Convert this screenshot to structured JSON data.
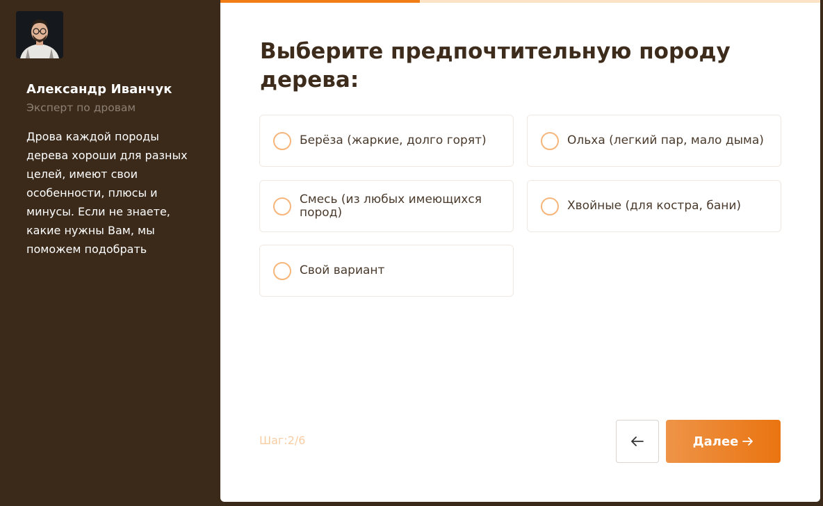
{
  "expert": {
    "name": "Александр Иванчук",
    "role": "Эксперт по дровам",
    "description": "Дрова каждой породы дерева хороши для разных целей, имеют свои особенности, плюсы и минусы. Если не знаете, какие нужны Вам, мы поможем подобрать"
  },
  "quiz": {
    "progress": 0.333,
    "question": "Выберите предпочтительную породу дерева:",
    "options": [
      {
        "label": "Берёза (жаркие, долго горят)"
      },
      {
        "label": "Ольха (легкий пар, мало дыма)"
      },
      {
        "label": "Смесь (из любых имеющихся пород)"
      },
      {
        "label": "Хвойные (для костра, бани)"
      },
      {
        "label": "Свой вариант"
      }
    ],
    "step": "Шаг:2/6",
    "back_icon": "arrow-left-icon",
    "next_label": "Далее",
    "next_icon": "arrow-right-icon"
  },
  "colors": {
    "sidebar_bg": "#3b2a1a",
    "accent": "#f07d16",
    "progress_track": "#fde3c5",
    "radio_border": "#f6b57a",
    "step_text": "#f8cda3"
  }
}
